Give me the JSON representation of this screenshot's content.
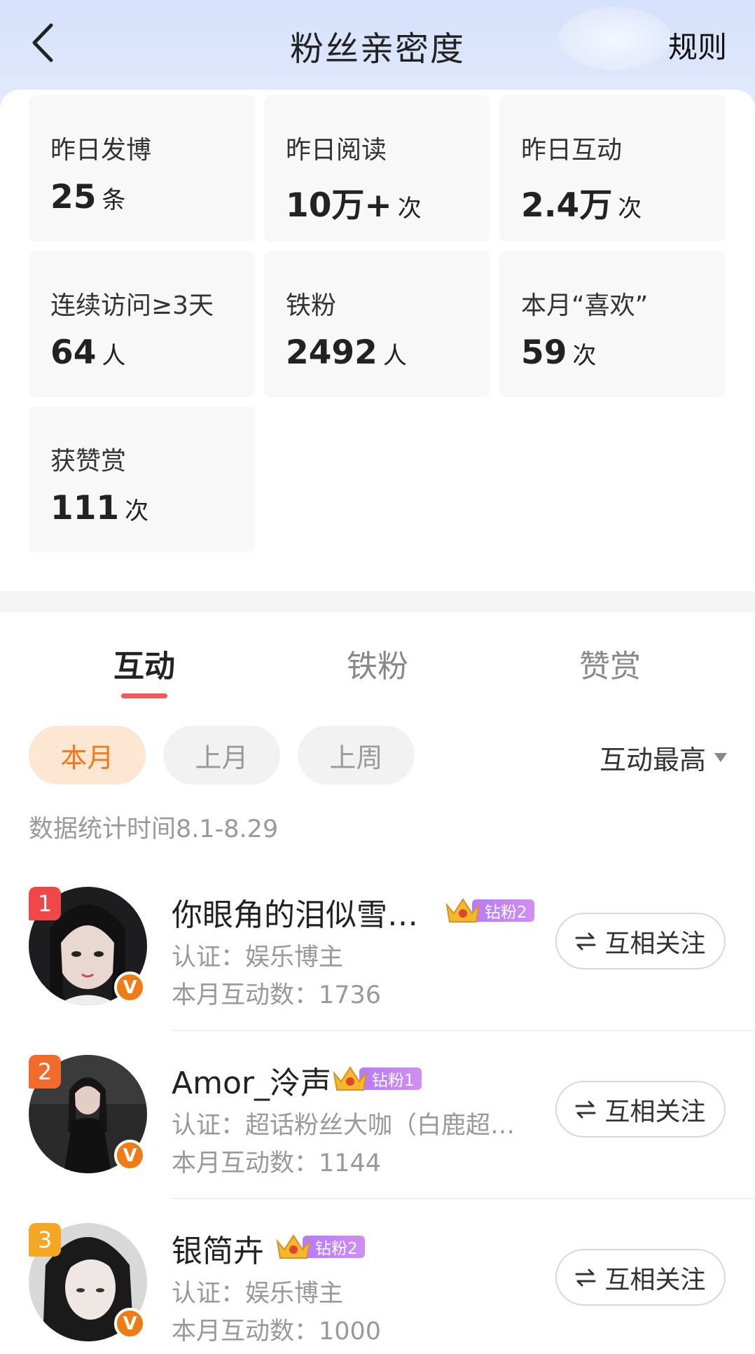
{
  "header": {
    "title": "粉丝亲密度",
    "rules_label": "规则"
  },
  "stats": [
    {
      "label": "昨日发博",
      "value": "25",
      "unit": "条"
    },
    {
      "label": "昨日阅读",
      "value": "10万+",
      "unit": "次"
    },
    {
      "label": "昨日互动",
      "value": "2.4万",
      "unit": "次"
    },
    {
      "label": "连续访问≥3天",
      "value": "64",
      "unit": "人"
    },
    {
      "label": "铁粉",
      "value": "2492",
      "unit": "人"
    },
    {
      "label": "本月“喜欢”",
      "value": "59",
      "unit": "次"
    },
    {
      "label": "获赞赏",
      "value": "111",
      "unit": "次"
    }
  ],
  "tabs": [
    {
      "label": "互动",
      "active": true
    },
    {
      "label": "铁粉",
      "active": false
    },
    {
      "label": "赞赏",
      "active": false
    }
  ],
  "filters": [
    {
      "label": "本月",
      "active": true
    },
    {
      "label": "上月",
      "active": false
    },
    {
      "label": "上周",
      "active": false
    }
  ],
  "sort_label": "互动最高",
  "period_text": "数据统计时间8.1-8.29",
  "users": [
    {
      "rank": "1",
      "rank_color": "#f04848",
      "name": "你眼角的泪似雪…",
      "fan_badge": "钻粉2",
      "cert": "认证：娱乐博主",
      "count": "本月互动数：1736",
      "follow_label": "互相关注",
      "verified": "V"
    },
    {
      "rank": "2",
      "rank_color": "#f36a2a",
      "name": "Amor_泠声",
      "fan_badge": "钻粉1",
      "cert": "认证：超话粉丝大咖（白鹿超…",
      "count": "本月互动数：1144",
      "follow_label": "互相关注",
      "verified": "V"
    },
    {
      "rank": "3",
      "rank_color": "#f5a623",
      "name": "银简卉",
      "fan_badge": "钻粉2",
      "cert": "认证：娱乐博主",
      "count": "本月互动数：1000",
      "follow_label": "互相关注",
      "verified": "V"
    }
  ]
}
